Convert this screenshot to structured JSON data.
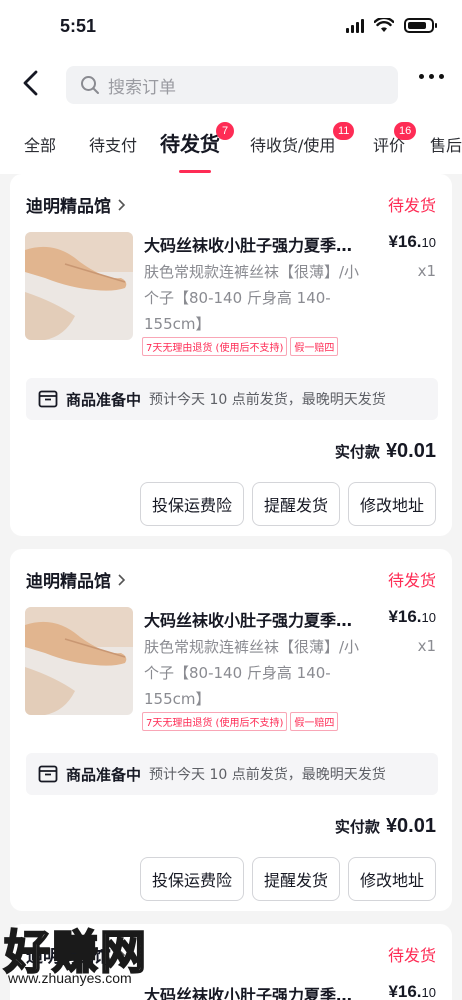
{
  "status_bar": {
    "time": "5:51"
  },
  "search": {
    "placeholder": "搜索订单"
  },
  "tabs": [
    {
      "label": "全部"
    },
    {
      "label": "待支付"
    },
    {
      "label": "待发货",
      "badge": "7",
      "active": true
    },
    {
      "label": "待收货/使用",
      "badge": "11"
    },
    {
      "label": "评价",
      "badge": "16"
    },
    {
      "label": "售后"
    }
  ],
  "orders": [
    {
      "shop": "迪明精品馆",
      "status": "待发货",
      "product_title": "大码丝袜收小肚子强力夏季薄款",
      "price_main": "¥16.",
      "price_cents": "10",
      "qty": "x1",
      "spec": "肤色常规款连裤丝袜【很薄】/小个子【80-140 斤身高 140-155cm】",
      "tags": [
        "7天无理由退货 (使用后不支持)",
        "假一赔四"
      ],
      "ship_status": "商品准备中",
      "ship_estimate": "预计今天 10 点前发货，最晚明天发货",
      "paid_label": "实付款",
      "paid_amount": "¥0.01",
      "buttons": [
        "投保运费险",
        "提醒发货",
        "修改地址"
      ]
    },
    {
      "shop": "迪明精品馆",
      "status": "待发货",
      "product_title": "大码丝袜收小肚子强力夏季薄款",
      "price_main": "¥16.",
      "price_cents": "10",
      "qty": "x1",
      "spec": "肤色常规款连裤丝袜【很薄】/小个子【80-140 斤身高 140-155cm】",
      "tags": [
        "7天无理由退货 (使用后不支持)",
        "假一赔四"
      ],
      "ship_status": "商品准备中",
      "ship_estimate": "预计今天 10 点前发货，最晚明天发货",
      "paid_label": "实付款",
      "paid_amount": "¥0.01",
      "buttons": [
        "投保运费险",
        "提醒发货",
        "修改地址"
      ]
    },
    {
      "shop": "迪明精品馆",
      "status": "待发货",
      "product_title": "大码丝袜收小肚子强力夏季薄款",
      "price_main": "¥16.",
      "price_cents": "10"
    }
  ],
  "watermark": {
    "text": "好赚网",
    "url": "www.zhuanyes.com"
  },
  "colors": {
    "accent": "#fe2c55",
    "background": "#f4f4f4"
  }
}
